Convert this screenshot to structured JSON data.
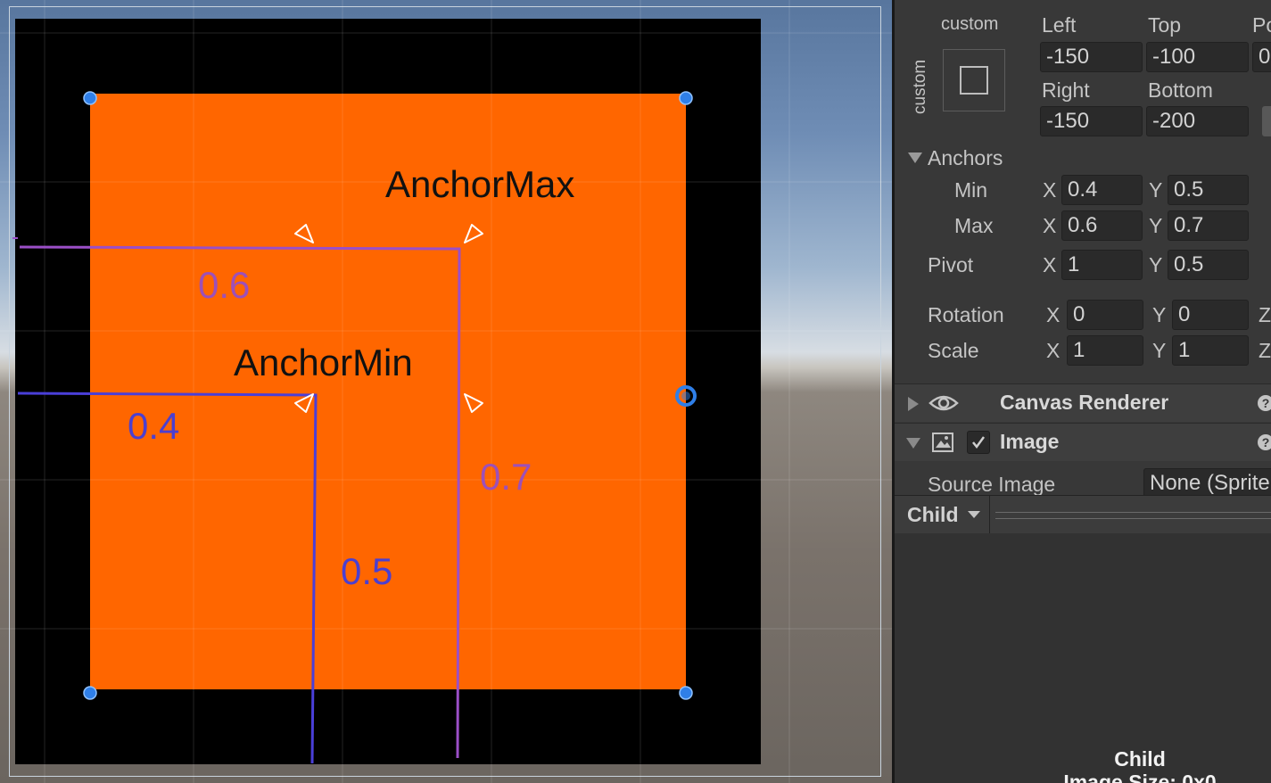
{
  "scene": {
    "labels": {
      "anchor_max": "AnchorMax",
      "anchor_min": "AnchorMin",
      "val_06": "0.6",
      "val_04": "0.4",
      "val_07": "0.7",
      "val_05": "0.5"
    },
    "colors": {
      "parent": "#000000",
      "child": "#ff6600",
      "anchor_min_line": "#4a3fd8",
      "anchor_max_line": "#9b4fc7",
      "handle": "#2f7fe8"
    }
  },
  "inspector": {
    "preset": {
      "top_label": "custom",
      "side_label": "custom"
    },
    "rect": {
      "left_label": "Left",
      "left_value": "-150",
      "top_label": "Top",
      "top_value": "-100",
      "pos_label": "Po",
      "pos_value": "0",
      "right_label": "Right",
      "right_value": "-150",
      "bottom_label": "Bottom",
      "bottom_value": "-200"
    },
    "anchors": {
      "header": "Anchors",
      "min_label": "Min",
      "min_x": "0.4",
      "min_y": "0.5",
      "max_label": "Max",
      "max_x": "0.6",
      "max_y": "0.7"
    },
    "pivot": {
      "label": "Pivot",
      "x": "1",
      "y": "0.5"
    },
    "rotation": {
      "label": "Rotation",
      "x": "0",
      "y": "0"
    },
    "scale": {
      "label": "Scale",
      "x": "1",
      "y": "1"
    },
    "axis": {
      "x": "X",
      "y": "Y",
      "z": "Z"
    },
    "components": {
      "canvas_renderer": "Canvas Renderer",
      "image": "Image",
      "help": "?"
    },
    "source_image": {
      "label": "Source Image",
      "value": "None (Sprite"
    },
    "preview": {
      "dropdown": "Child",
      "title": "Child",
      "subtitle": "Image Size: 0x0"
    }
  }
}
